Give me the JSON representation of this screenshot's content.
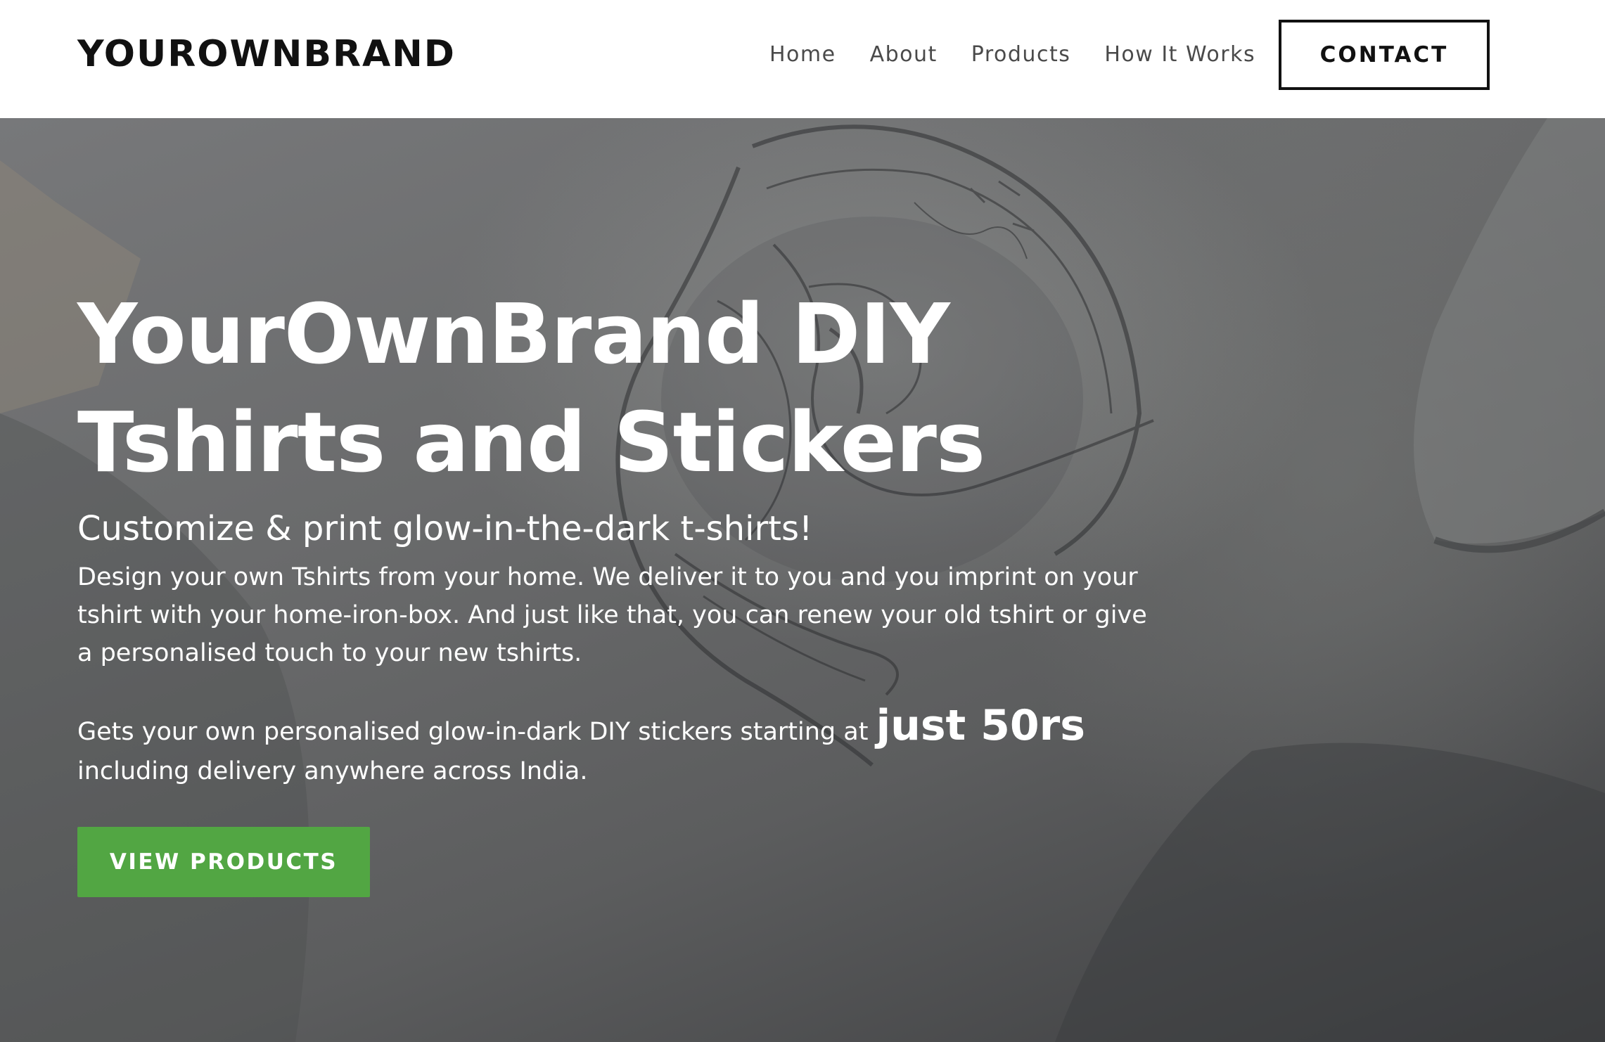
{
  "header": {
    "brand": "YOUROWNBRAND",
    "nav": [
      "Home",
      "About",
      "Products",
      "How It Works"
    ],
    "contact_label": "CONTACT"
  },
  "hero": {
    "title_line1": "YourOwnBrand DIY",
    "title_line2": "Tshirts and Stickers",
    "subtitle": "Customize & print glow-in-the-dark t-shirts!",
    "description": "Design your own Tshirts from your home. We deliver it to you and you imprint on your tshirt with your home-iron-box. And just like that, you can renew your old tshirt or give a personalised touch to your new tshirts.",
    "offer_before": "Gets your own personalised glow-in-dark DIY stickers starting at ",
    "offer_price": "just 50rs",
    "offer_after": " including delivery anywhere across India.",
    "cta_label": "VIEW PRODUCTS"
  },
  "colors": {
    "header_bg": "#ffffff",
    "brand_text": "#111111",
    "nav_text": "#4a4a4a",
    "cta_bg": "#52a643",
    "hero_text": "#ffffff"
  },
  "icons": {
    "hero_background": "tshirt-sketch-photo"
  }
}
